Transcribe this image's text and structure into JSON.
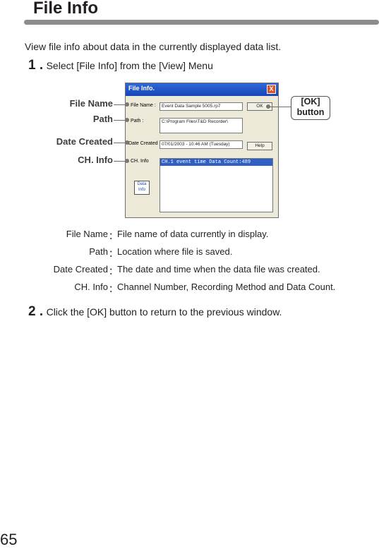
{
  "page": {
    "title": "File Info",
    "intro": "View file info about data in the currently displayed data list.",
    "page_number": "65"
  },
  "steps": [
    {
      "number": "1 .",
      "text": "Select [File Info] from the [View] Menu"
    },
    {
      "number": "2 .",
      "text": "Click the [OK] button to return to the previous window."
    }
  ],
  "callouts": {
    "file_name": "File Name",
    "path": "Path",
    "date_created": "Date Created",
    "ch_info": "CH. Info",
    "ok_line1": "[OK]",
    "ok_line2": "button"
  },
  "dialog": {
    "title": "File Info.",
    "close": "X",
    "file_name_label": "File Name :",
    "file_name_value": "Event Data Sample 5005.rp7",
    "path_label": "Path :",
    "path_value": "C:\\Program Files\\T&D Recorder\\",
    "date_label": "Date Created",
    "date_value": "07/01/2003 - 10:46 AM (Tuesday)",
    "ch_label": "CH. Info",
    "ch_value": "CH.1  event time Data Count:489",
    "ok_button": "OK",
    "help_button": "Help",
    "data_icon_line1": "Data",
    "data_icon_line2": "Info"
  },
  "definitions": [
    {
      "term": "File Name",
      "colon": "：",
      "desc": "File name of data currently in display."
    },
    {
      "term": "Path",
      "colon": "：",
      "desc": "Location where file is saved."
    },
    {
      "term": "Date Created",
      "colon": "：",
      "desc": "The date and time when the data file was created."
    },
    {
      "term": "CH. Info",
      "colon": "：",
      "desc": "Channel Number, Recording Method and Data Count."
    }
  ]
}
